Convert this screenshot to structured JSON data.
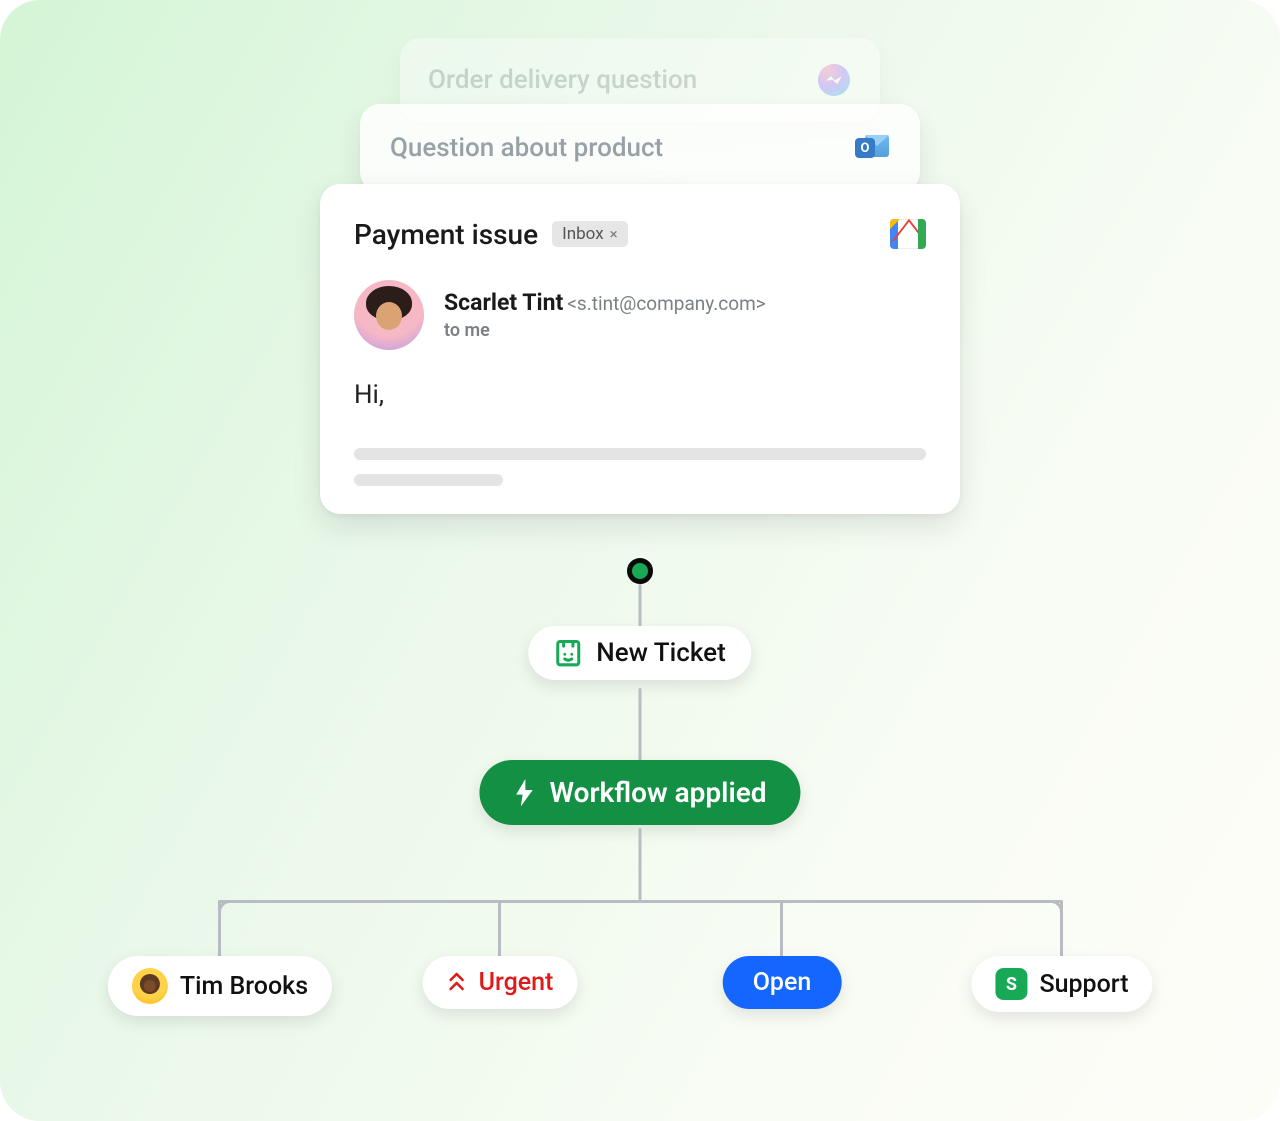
{
  "cards": {
    "back": {
      "title": "Order delivery question",
      "source": "messenger"
    },
    "mid": {
      "title": "Question about product",
      "source": "outlook"
    },
    "front": {
      "title": "Payment issue",
      "chip": "Inbox",
      "source": "gmail",
      "sender": {
        "name": "Scarlet Tint",
        "email": "<s.tint@company.com>",
        "to": "to me"
      },
      "body_first_line": "Hi,"
    }
  },
  "flow": {
    "new_ticket": "New Ticket",
    "workflow": "Workflow applied",
    "branches": {
      "assignee": {
        "name": "Tim Brooks"
      },
      "priority": {
        "label": "Urgent"
      },
      "status": {
        "label": "Open"
      },
      "group": {
        "initial": "S",
        "label": "Support"
      }
    }
  },
  "colors": {
    "brand_green": "#149045",
    "accent_blue": "#1565ff",
    "urgent_red": "#e01919"
  }
}
